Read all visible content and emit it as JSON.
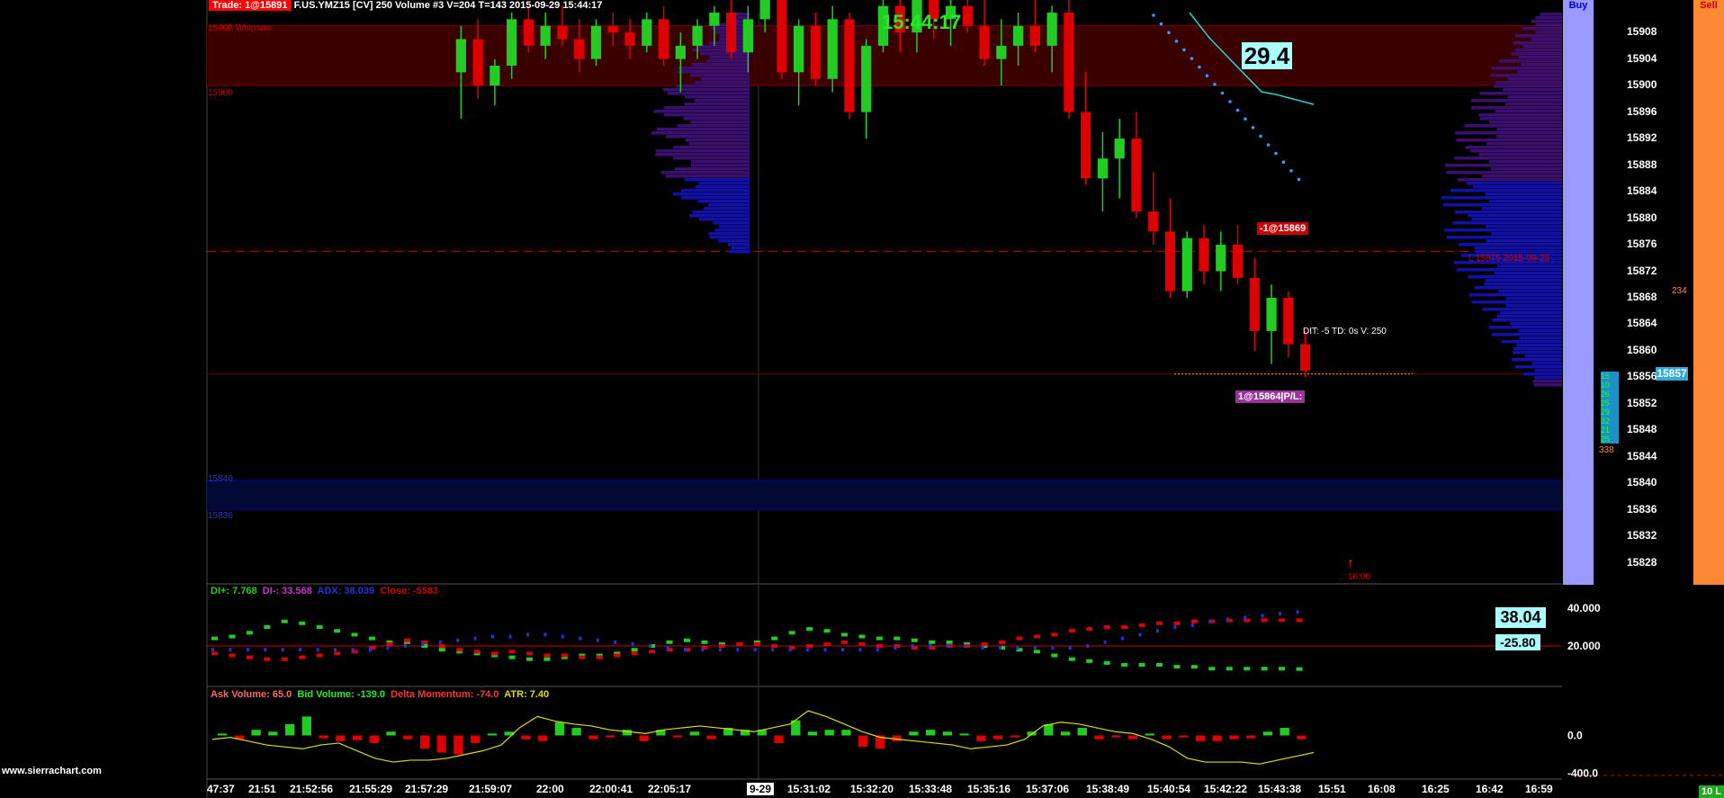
{
  "header": {
    "trade_label": "Trade: 1@15891",
    "info": "F.US.YMZ15 [CV]  250 Volume  #3 V=204 T=143 2015-09-29 15:44:17"
  },
  "buttons": {
    "buy": "Buy",
    "sell": "Sell"
  },
  "clock": "15:44:17",
  "big_value": "29.4",
  "levels": {
    "whipsaw": "15908 Whipsaw",
    "l15900": "15900",
    "l15840": "15840",
    "l15836": "15836",
    "prior": "L 15875  2015-09-28"
  },
  "order_tag": "-1@15869",
  "dit": "DIT: -5  TD: 0s  V: 250",
  "position_tag": "1@15864|P/L:",
  "current_price": "15857",
  "target_time": "16:00",
  "ladder_top": "234",
  "ladder_bottom": "338",
  "ladder_values": [
    "15",
    "10",
    "26",
    "25",
    "29",
    "32",
    "21",
    "25"
  ],
  "watermark": "www.sierrachart.com",
  "corner_value": "10 L",
  "colors": {
    "up": "#22cc22",
    "down": "#dd0000",
    "buy_bg": "#9999ff",
    "sell_bg": "#ff8833",
    "profile": "#3a0f70",
    "profile_va": "#1111aa",
    "zone": "#3a0000",
    "adx": "#2233dd",
    "atr": "#dddd00"
  },
  "chart_data": [
    {
      "type": "candlestick",
      "title": "F.US.YMZ15 [CV] 250 Volume",
      "y_ticks": [
        15908,
        15904,
        15900,
        15896,
        15892,
        15888,
        15884,
        15880,
        15876,
        15872,
        15868,
        15864,
        15860,
        15856,
        15852,
        15848,
        15844,
        15840,
        15836,
        15832,
        15828
      ],
      "ylim": [
        15825,
        15911
      ],
      "x_ticks": [
        "47:37",
        "21:51",
        "21:52:56",
        "21:55:29",
        "21:57:29",
        "21:59:07",
        "22:00",
        "22:00:41",
        "22:05:17",
        "9-29",
        "15:31:02",
        "15:32:20",
        "15:33:48",
        "15:35:16",
        "15:37:06",
        "15:38:49",
        "15:40:54",
        "15:42:22",
        "15:43:38",
        "15:51",
        "16:08",
        "16:25",
        "16:42",
        "16:59"
      ],
      "candles": [
        [
          15902,
          15909,
          15895,
          15907
        ],
        [
          15907,
          15910,
          15898,
          15900
        ],
        [
          15900,
          15904,
          15897,
          15903
        ],
        [
          15903,
          15911,
          15901,
          15910
        ],
        [
          15910,
          15912,
          15905,
          15906
        ],
        [
          15906,
          15911,
          15904,
          15909
        ],
        [
          15909,
          15912,
          15906,
          15907
        ],
        [
          15907,
          15910,
          15902,
          15904
        ],
        [
          15904,
          15910,
          15903,
          15909
        ],
        [
          15909,
          15911,
          15906,
          15908
        ],
        [
          15908,
          15910,
          15904,
          15906
        ],
        [
          15906,
          15911,
          15905,
          15910
        ],
        [
          15910,
          15912,
          15903,
          15904
        ],
        [
          15904,
          15908,
          15899,
          15906
        ],
        [
          15906,
          15910,
          15904,
          15909
        ],
        [
          15909,
          15912,
          15906,
          15911
        ],
        [
          15911,
          15913,
          15904,
          15905
        ],
        [
          15905,
          15912,
          15902,
          15910
        ],
        [
          15910,
          15915,
          15908,
          15913
        ],
        [
          15913,
          15914,
          15901,
          15902
        ],
        [
          15902,
          15910,
          15897,
          15909
        ],
        [
          15909,
          15911,
          15900,
          15901
        ],
        [
          15901,
          15912,
          15899,
          15910
        ],
        [
          15910,
          15911,
          15895,
          15896
        ],
        [
          15896,
          15907,
          15892,
          15906
        ],
        [
          15906,
          15913,
          15905,
          15912
        ],
        [
          15912,
          15914,
          15905,
          15908
        ],
        [
          15908,
          15914,
          15905,
          15913
        ],
        [
          15913,
          15915,
          15907,
          15910
        ],
        [
          15910,
          15913,
          15906,
          15912
        ],
        [
          15912,
          15914,
          15908,
          15909
        ],
        [
          15909,
          15913,
          15903,
          15904
        ],
        [
          15904,
          15910,
          15900,
          15906
        ],
        [
          15906,
          15911,
          15903,
          15909
        ],
        [
          15909,
          15913,
          15905,
          15906
        ],
        [
          15906,
          15912,
          15902,
          15911
        ],
        [
          15911,
          15914,
          15895,
          15896
        ],
        [
          15896,
          15902,
          15885,
          15886
        ],
        [
          15886,
          15893,
          15881,
          15889
        ],
        [
          15889,
          15895,
          15883,
          15892
        ],
        [
          15892,
          15896,
          15880,
          15881
        ],
        [
          15881,
          15887,
          15876,
          15878
        ],
        [
          15878,
          15883,
          15868,
          15869
        ],
        [
          15869,
          15878,
          15868,
          15877
        ],
        [
          15877,
          15879,
          15870,
          15872
        ],
        [
          15872,
          15878,
          15869,
          15876
        ],
        [
          15876,
          15879,
          15870,
          15871
        ],
        [
          15871,
          15874,
          15860,
          15863
        ],
        [
          15863,
          15870,
          15858,
          15868
        ],
        [
          15868,
          15869,
          15859,
          15861
        ],
        [
          15861,
          15863,
          15856,
          15857
        ]
      ]
    },
    {
      "type": "line",
      "title": "DI+ / DI- / ADX",
      "legend": [
        "DI+: 7.768",
        "DI-: 33.568",
        "ADX: 38.039",
        "Close: -5583"
      ],
      "y_ticks": [
        40,
        20
      ],
      "ylim": [
        0,
        50
      ],
      "values_shown": [
        "38.04",
        "-25.80"
      ],
      "di_plus": [
        24,
        25,
        27,
        30,
        33,
        32,
        30,
        28,
        26,
        24,
        22,
        22,
        20,
        18,
        17,
        16,
        15,
        14,
        13,
        13,
        14,
        15,
        15,
        16,
        18,
        20,
        22,
        23,
        22,
        21,
        21,
        22,
        24,
        27,
        29,
        28,
        26,
        25,
        24,
        24,
        23,
        22,
        22,
        21,
        20,
        19,
        18,
        17,
        15,
        13,
        12,
        11,
        10,
        10,
        10,
        9,
        9,
        8,
        8,
        8,
        8,
        8,
        7.8
      ],
      "di_minus": [
        16,
        15,
        14,
        13,
        13,
        14,
        15,
        16,
        17,
        19,
        21,
        23,
        22,
        20,
        18,
        17,
        16,
        17,
        16,
        15,
        15,
        14,
        14,
        15,
        16,
        17,
        18,
        18,
        19,
        20,
        21,
        21,
        20,
        19,
        20,
        21,
        22,
        21,
        20,
        20,
        19,
        19,
        20,
        20,
        21,
        22,
        24,
        25,
        26,
        28,
        29,
        30,
        30,
        31,
        32,
        32,
        33,
        33,
        33.5,
        33.5,
        33.6,
        33.6,
        33.6
      ],
      "adx": [
        18,
        18,
        18,
        18,
        18,
        18,
        18,
        18,
        18,
        18,
        19,
        20,
        21,
        22,
        23,
        24,
        25,
        25,
        26,
        26,
        25,
        24,
        23,
        22,
        21,
        20,
        19,
        18,
        18,
        18,
        18,
        18,
        18,
        18,
        18,
        18,
        18,
        18,
        18,
        19,
        20,
        20,
        20,
        20,
        19,
        19,
        19,
        19,
        19,
        19,
        20,
        22,
        24,
        26,
        28,
        30,
        31,
        33,
        34,
        35,
        36,
        37,
        38
      ]
    },
    {
      "type": "bar",
      "title": "Ask Volume / Bid Volume / Delta Momentum / ATR",
      "legend": [
        "Ask Volume: 65.0",
        "Bid Volume: -139.0",
        "Delta Momentum: -74.0",
        "ATR: 7.40"
      ],
      "y_ticks": [
        0.0,
        -400.0
      ],
      "ylim": [
        -450,
        450
      ],
      "delta": [
        20,
        -40,
        60,
        40,
        120,
        200,
        -30,
        -60,
        -50,
        -80,
        40,
        -40,
        -140,
        -180,
        -200,
        -80,
        20,
        40,
        -40,
        -60,
        140,
        80,
        -40,
        -20,
        60,
        -60,
        60,
        -20,
        40,
        -40,
        80,
        60,
        60,
        -80,
        160,
        40,
        60,
        60,
        -120,
        -140,
        -60,
        40,
        60,
        40,
        20,
        -60,
        -40,
        -20,
        40,
        120,
        40,
        80,
        -40,
        -20,
        -40,
        20,
        -40,
        -20,
        -60,
        -60,
        -40,
        -30,
        40,
        80,
        -40
      ],
      "atr": [
        -40,
        -20,
        -60,
        -100,
        -120,
        -140,
        -100,
        -80,
        -160,
        -240,
        -280,
        -260,
        -260,
        -240,
        -200,
        -160,
        -100,
        80,
        200,
        150,
        120,
        100,
        60,
        40,
        20,
        60,
        80,
        100,
        80,
        60,
        40,
        80,
        120,
        260,
        200,
        120,
        40,
        -20,
        -40,
        -60,
        -80,
        -100,
        -140,
        -120,
        -100,
        -40,
        100,
        140,
        120,
        80,
        40,
        20,
        -40,
        -120,
        -240,
        -280,
        -280,
        -280,
        -300,
        -260,
        -220,
        -180
      ]
    }
  ]
}
